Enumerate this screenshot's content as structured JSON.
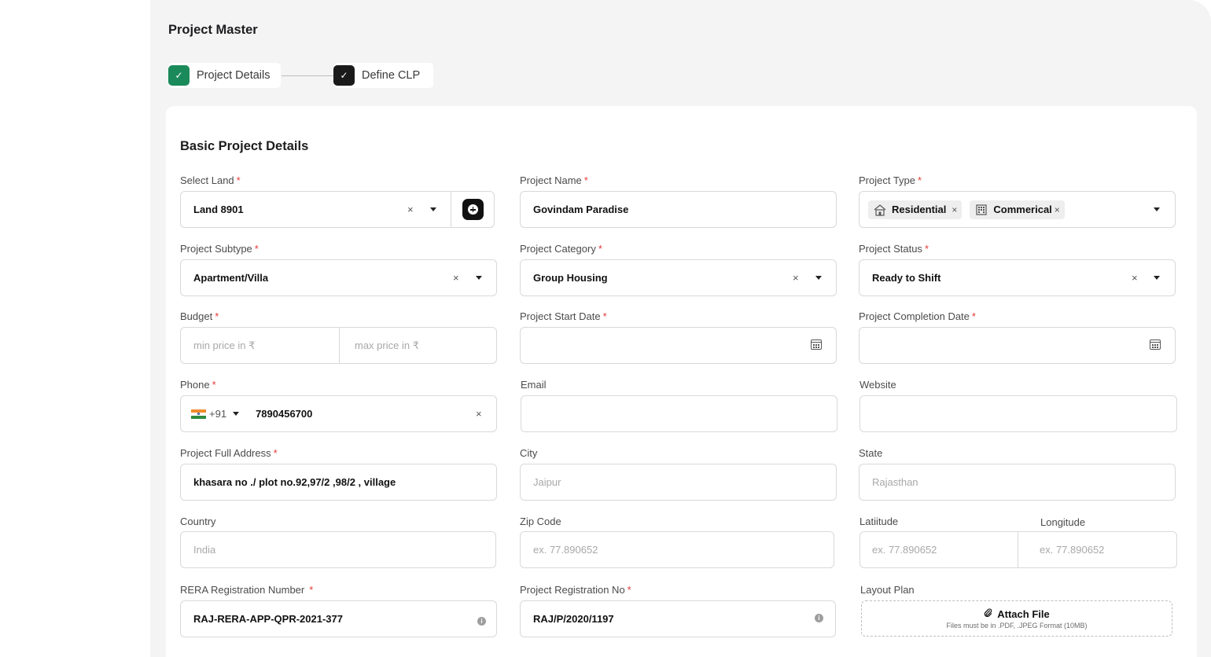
{
  "page": {
    "title": "Project Master"
  },
  "steps": [
    {
      "label": "Project Details",
      "check": "✓"
    },
    {
      "label": "Define CLP",
      "check": "✓"
    }
  ],
  "section": {
    "title": "Basic Project Details"
  },
  "required_mark": "*",
  "clear_symbol": "×",
  "fields": {
    "select_land": {
      "label": "Select Land",
      "value": "Land 8901"
    },
    "project_name": {
      "label": "Project Name",
      "value": "Govindam Paradise"
    },
    "project_type": {
      "label": "Project Type",
      "chips": [
        {
          "label": "Residential",
          "icon": "house-icon"
        },
        {
          "label": "Commerical",
          "icon": "building-icon"
        }
      ]
    },
    "project_subtype": {
      "label": "Project Subtype",
      "value": "Apartment/Villa"
    },
    "project_category": {
      "label": "Project Category",
      "value": "Group Housing"
    },
    "project_status": {
      "label": "Project Status",
      "value": "Ready to Shift"
    },
    "budget": {
      "label": "Budget",
      "min_placeholder": "min price in ₹",
      "max_placeholder": "max price in ₹"
    },
    "start_date": {
      "label": "Project Start Date",
      "value": ""
    },
    "completion_date": {
      "label": "Project Completion Date",
      "value": ""
    },
    "phone": {
      "label": "Phone",
      "country_code": "+91",
      "value": "7890456700"
    },
    "email": {
      "label": "Email",
      "value": ""
    },
    "website": {
      "label": "Website",
      "value": ""
    },
    "address": {
      "label": "Project Full Address",
      "value": "khasara no ./ plot no.92,97/2 ,98/2 , village"
    },
    "city": {
      "label": "City",
      "placeholder": "Jaipur"
    },
    "state": {
      "label": "State",
      "placeholder": "Rajasthan"
    },
    "country": {
      "label": "Country",
      "placeholder": "India"
    },
    "zip": {
      "label": "Zip Code",
      "placeholder": "ex. 77.890652"
    },
    "latitude": {
      "label": "Latiitude",
      "placeholder": "ex. 77.890652"
    },
    "longitude": {
      "label": "Longitude",
      "placeholder": "ex. 77.890652"
    },
    "rera": {
      "label": "RERA Registration Number",
      "value": "RAJ-RERA-APP-QPR-2021-377"
    },
    "registration_no": {
      "label": "Project Registration No",
      "value": "RAJ/P/2020/1197"
    },
    "layout_plan": {
      "label": "Layout Plan",
      "attach_label": "Attach File",
      "hint": "Files must be in .PDF, .JPEG Format (10MB)"
    }
  },
  "colors": {
    "accent_green": "#1b8a5a",
    "required_red": "#e53935",
    "page_bg": "#f4f4f5"
  }
}
